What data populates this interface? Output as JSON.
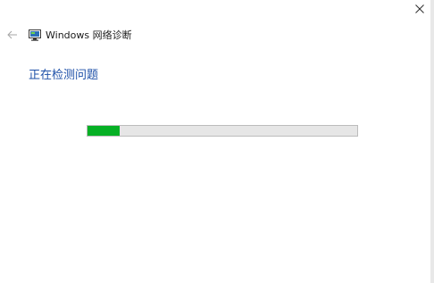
{
  "window": {
    "title": "Windows 网络诊断",
    "app_icon": "network-diagnostics-icon"
  },
  "titlebar": {
    "back_icon": "back-arrow-icon",
    "close_icon": "close-icon"
  },
  "content": {
    "status_heading": "正在检测问题",
    "progress": {
      "percent": 12,
      "fill_color": "#06b025",
      "track_color": "#e6e6e6"
    }
  },
  "colors": {
    "heading": "#1e50a8",
    "background": "#ffffff"
  }
}
